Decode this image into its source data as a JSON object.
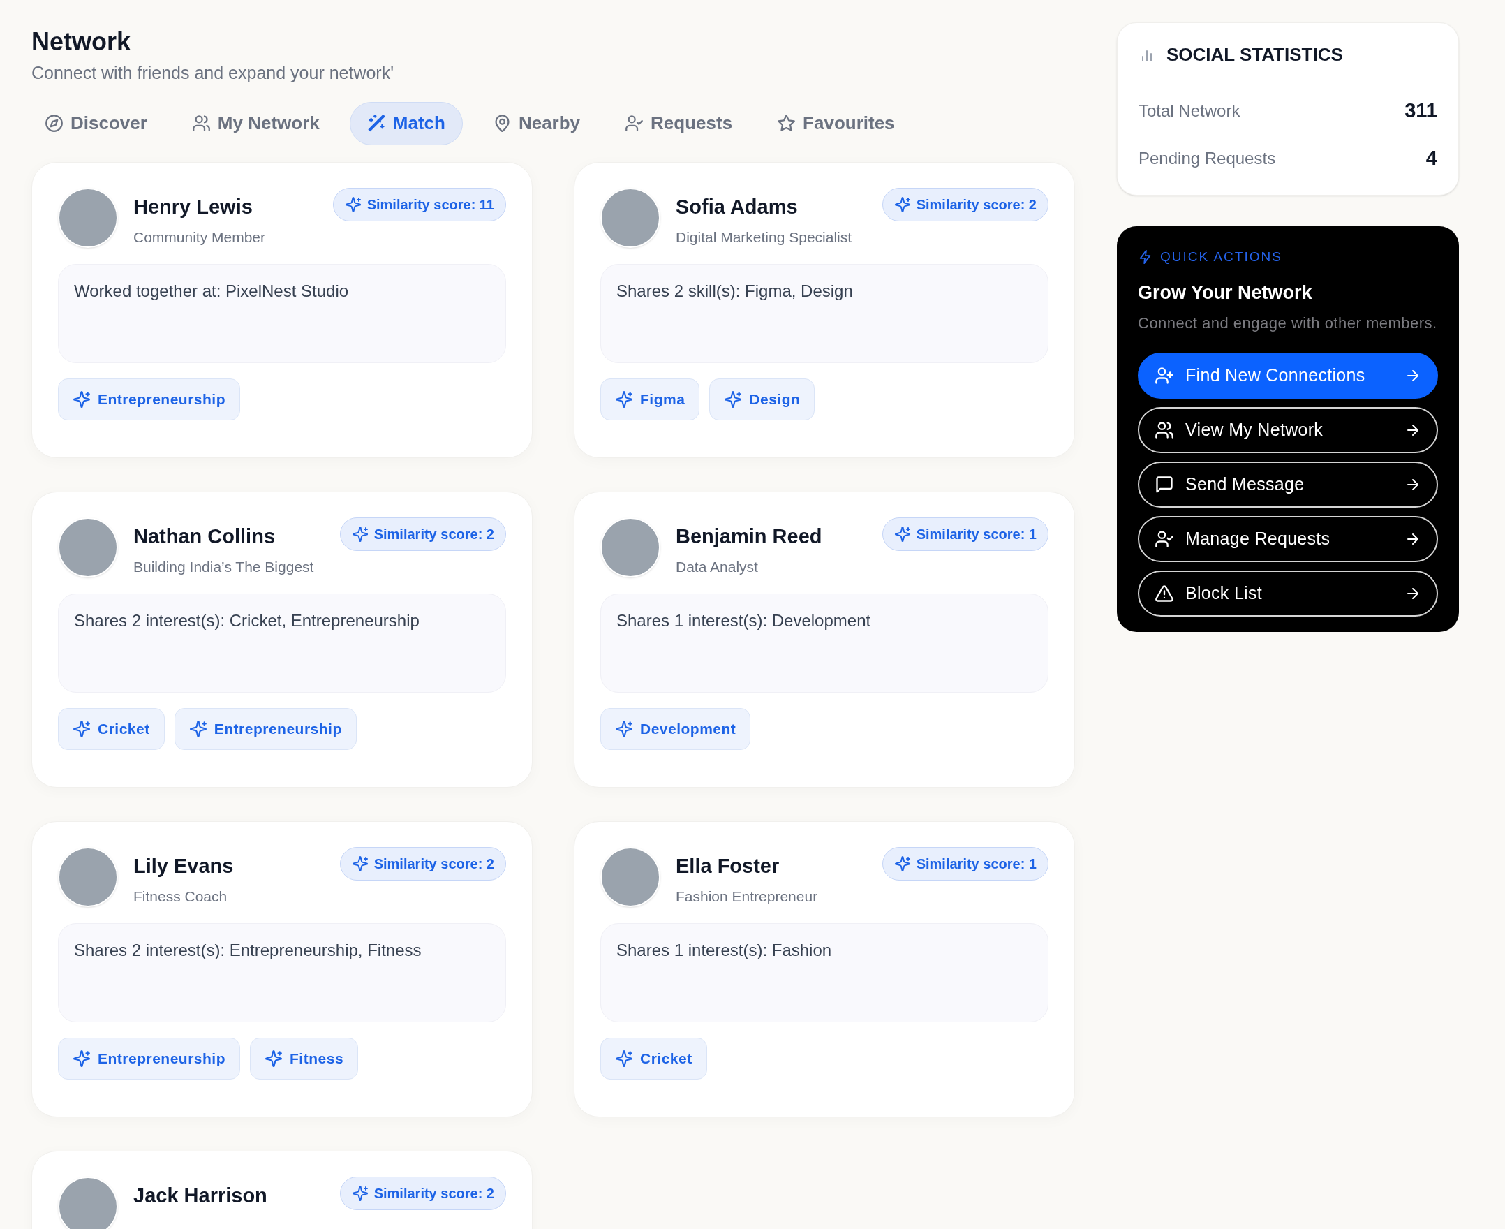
{
  "header": {
    "title": "Network",
    "subtitle": "Connect with friends and expand your network'"
  },
  "tabs": [
    {
      "label": "Discover",
      "selected": false
    },
    {
      "label": "My Network",
      "selected": false
    },
    {
      "label": "Match",
      "selected": true
    },
    {
      "label": "Nearby",
      "selected": false
    },
    {
      "label": "Requests",
      "selected": false
    },
    {
      "label": "Favourites",
      "selected": false
    }
  ],
  "matches": [
    {
      "name": "Henry Lewis",
      "role": "Community Member",
      "score": "Similarity score: 11",
      "reason": "Worked together at: PixelNest Studio",
      "tags": [
        "Entrepreneurship"
      ]
    },
    {
      "name": "Sofia Adams",
      "role": "Digital Marketing Specialist",
      "score": "Similarity score: 2",
      "reason": "Shares 2 skill(s): Figma, Design",
      "tags": [
        "Figma",
        "Design"
      ]
    },
    {
      "name": "Nathan Collins",
      "role": "Building India’s The Biggest",
      "score": "Similarity score: 2",
      "reason": "Shares 2 interest(s): Cricket, Entrepreneurship",
      "tags": [
        "Cricket",
        "Entrepreneurship"
      ]
    },
    {
      "name": "Benjamin Reed",
      "role": "Data Analyst",
      "score": "Similarity score: 1",
      "reason": "Shares 1 interest(s): Development",
      "tags": [
        "Development"
      ]
    },
    {
      "name": "Lily Evans",
      "role": "Fitness Coach",
      "score": "Similarity score: 2",
      "reason": "Shares 2 interest(s): Entrepreneurship, Fitness",
      "tags": [
        "Entrepreneurship",
        "Fitness"
      ]
    },
    {
      "name": "Ella Foster",
      "role": "Fashion Entrepreneur",
      "score": "Similarity score: 1",
      "reason": "Shares 1 interest(s): Fashion",
      "tags": [
        "Cricket"
      ]
    },
    {
      "name": "Jack Harrison",
      "score": "Similarity score: 2"
    }
  ],
  "social_statistics": {
    "title": "SOCIAL STATISTICS",
    "rows": [
      {
        "label": "Total Network",
        "value": "311"
      },
      {
        "label": "Pending Requests",
        "value": "4"
      }
    ]
  },
  "quick_actions": {
    "eyebrow": "QUICK ACTIONS",
    "title": "Grow Your Network",
    "description": "Connect and engage with other members.",
    "buttons": [
      {
        "label": "Find New Connections",
        "highlighted": true
      },
      {
        "label": "View My Network",
        "highlighted": false
      },
      {
        "label": "Send Message",
        "highlighted": false
      },
      {
        "label": "Manage Requests",
        "highlighted": false
      },
      {
        "label": "Block List",
        "highlighted": false
      }
    ]
  }
}
